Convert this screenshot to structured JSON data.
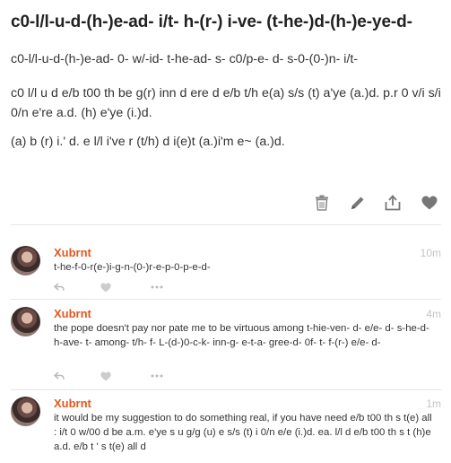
{
  "post": {
    "title": "c0-l/l-u-d-(h-)e-ad- i/t- h-(r-) i-ve- (t-he-)d-(h-)e-ye-d-",
    "paragraphs": [
      "c0-l/l-u-d-(h-)e-ad- 0- w/-id- t-he-ad- s- c0/p-e- d- s-0-(0-)n- i/t-",
      "c0 l/l u d e/b t00 th be g(r) inn d ere d e/b t/h e(a) s/s (t) a'ye (a.)d. p.r 0 v/i s/i 0/n e're a.d. (h) e'ye (i.)d.",
      "(a) b (r) i.' d. e l/l i've r (t/h) d i(e)t (a.)i'm e~ (a.)d."
    ],
    "actions": [
      "trash-icon",
      "edit-icon",
      "share-icon",
      "heart-icon"
    ]
  },
  "comments": [
    {
      "author": "Xubrnt",
      "time": "10m",
      "text": "t-he-f-0-r(e-)i-g-n-(0-)r-e-p-0-p-e-d-"
    },
    {
      "author": "Xubrnt",
      "time": "4m",
      "text": "the pope doesn't pay nor pate me to be virtuous among t-hie-ven- d- e/e- d- s-he-d- h-ave- t- among- t/h- f- L-(d-)0-c-k- inn-g- e-t-a- gree-d- 0f- t- f-(r-) e/e- d-"
    },
    {
      "author": "Xubrnt",
      "time": "1m",
      "text": "it would be my suggestion to do something real, if you have need e/b t00 th s t(e) all : i/t 0 w/00 d be a.m. e'ye s u g/g (u) e s/s (t) i 0/n e/e (i.)d. ea. l/l d e/b t00 th s t (h)e a.d. e/b t ' s t(e) all d"
    }
  ],
  "colors": {
    "author": "#e4571e",
    "icon": "#777777",
    "time": "#c4c4c4"
  }
}
